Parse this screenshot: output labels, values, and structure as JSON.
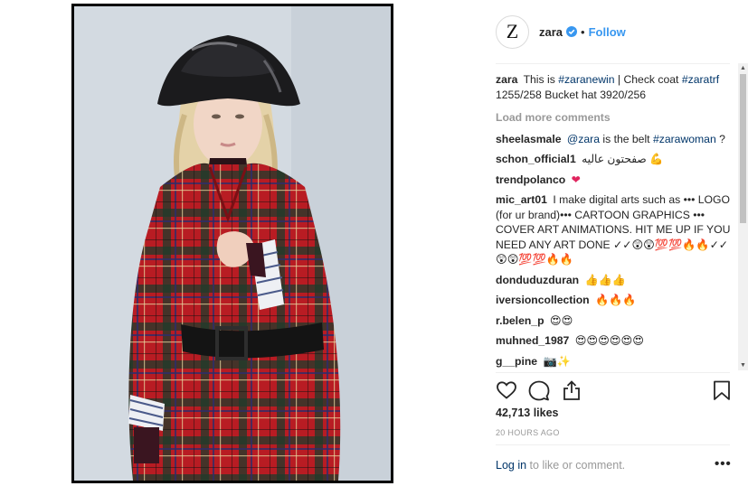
{
  "post": {
    "author": "zara",
    "avatar_letter": "Z",
    "dot": "•",
    "follow_label": "Follow",
    "verified_icon": "verified-badge-icon",
    "accent_color": "#3897f0",
    "likes": "42,713 likes",
    "time": "20 HOURS AGO"
  },
  "caption": {
    "user": "zara",
    "pre": "This is",
    "tag1": "#zaranewin",
    "mid": "| Check coat",
    "tag2": "#zaratrf",
    "post": "1255/258 Bucket hat 3920/256"
  },
  "load_more": "Load more comments",
  "comments": [
    {
      "user": "sheelasmale",
      "mention": "@zara",
      "text": " is the belt ",
      "tag": "#zarawoman",
      "tail": " ?"
    },
    {
      "user": "schon_official1",
      "text": "صفحتون عاليه 💪"
    },
    {
      "user": "trendpolanco",
      "text": "❤"
    },
    {
      "user": "mic_art01",
      "text": "I make digital arts such as ••• LOGO (for ur brand)••• CARTOON GRAPHICS ••• COVER ART ANIMATIONS. HIT ME UP IF YOU NEED ANY ART DONE ✓✓😲😲💯💯🔥🔥✓✓😲😲💯💯🔥🔥"
    },
    {
      "user": "donduduzduran",
      "text": "👍👍👍"
    },
    {
      "user": "iversioncollection",
      "text": "🔥🔥🔥"
    },
    {
      "user": "r.belen_p",
      "text": "😍😍"
    },
    {
      "user": "muhned_1987",
      "text": "😍😍😍😍😍😍"
    },
    {
      "user": "g__pine",
      "text": "📷✨"
    }
  ],
  "footer": {
    "login_link": "Log in",
    "login_text": "to like or comment.",
    "more": "•••"
  },
  "icons": {
    "like": "heart-icon",
    "comment": "comment-icon",
    "share": "share-icon",
    "save": "bookmark-icon"
  }
}
